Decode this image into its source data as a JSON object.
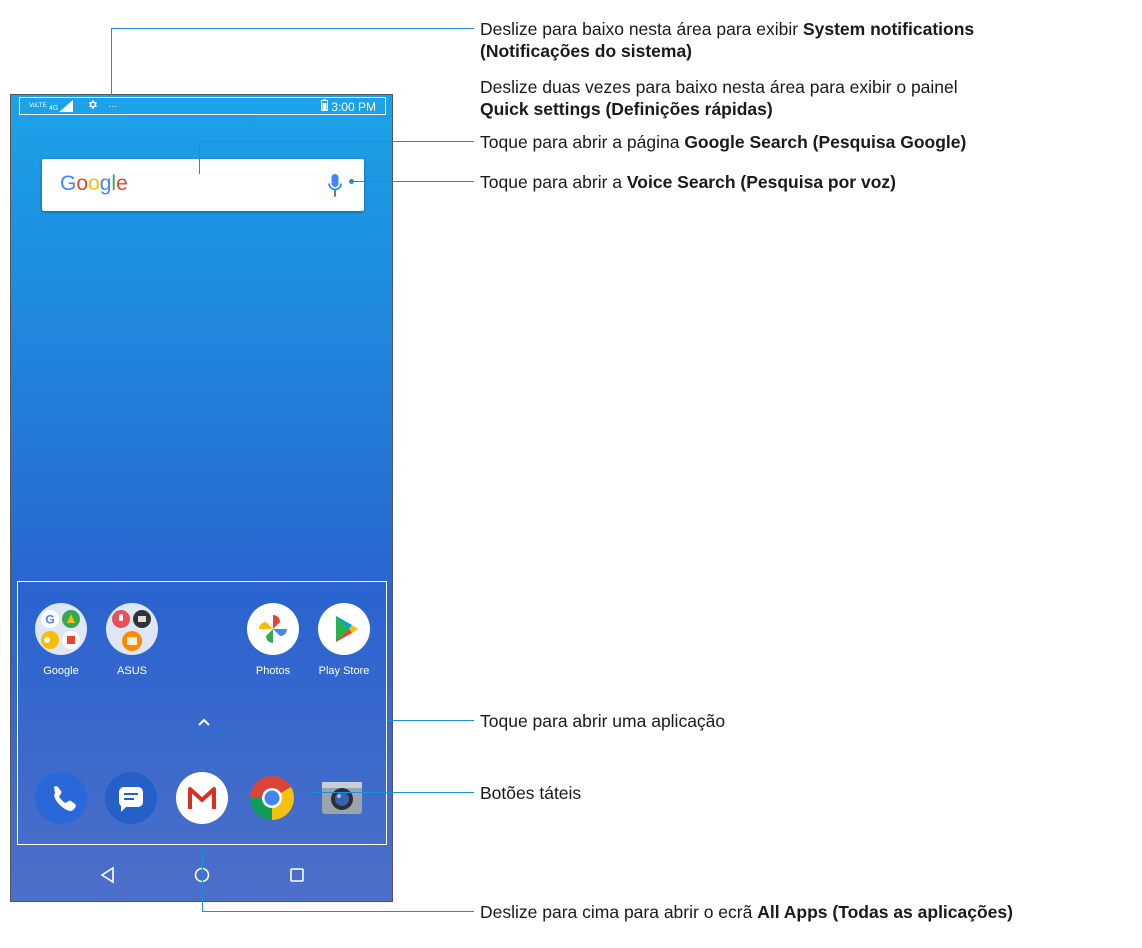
{
  "statusbar": {
    "network": "4G",
    "volte": "VoLTE",
    "more": "···",
    "time": "3:00 PM"
  },
  "search_widget": {
    "logo_text": "Google",
    "logo_colors": [
      "#4285F4",
      "#EA4335",
      "#FBBC05",
      "#4285F4",
      "#34A853",
      "#EA4335"
    ]
  },
  "apps_row": [
    {
      "label": "Google"
    },
    {
      "label": "ASUS"
    },
    {
      "label": "Photos"
    },
    {
      "label": "Play Store"
    }
  ],
  "dock": [
    {
      "name": "phone-icon"
    },
    {
      "name": "messages-icon"
    },
    {
      "name": "gmail-icon"
    },
    {
      "name": "chrome-icon"
    },
    {
      "name": "camera-icon"
    }
  ],
  "annotations": {
    "notifications_1": "Deslize para baixo nesta área para exibir ",
    "notifications_1_bold": "System notifications",
    "notifications_2_bold": "(Notificações do sistema)",
    "quick_1": "Deslize duas vezes para baixo nesta área para exibir o painel",
    "quick_2_bold": "Quick settings (Definições rápidas)",
    "google_search": "Toque para abrir a página ",
    "google_search_bold": "Google Search (Pesquisa Google)",
    "voice_search": "Toque para abrir a ",
    "voice_search_bold": "Voice Search (Pesquisa por voz)",
    "open_app": "Toque para abrir uma aplicação",
    "touch_buttons": "Botões táteis",
    "all_apps": "Deslize para cima para abrir o ecrã ",
    "all_apps_bold": "All Apps (Todas as aplicações)"
  },
  "colors": {
    "callout_line": "#1d8fd4",
    "screen_top": "#1ba3e8",
    "screen_bottom": "#4d6fc9"
  }
}
